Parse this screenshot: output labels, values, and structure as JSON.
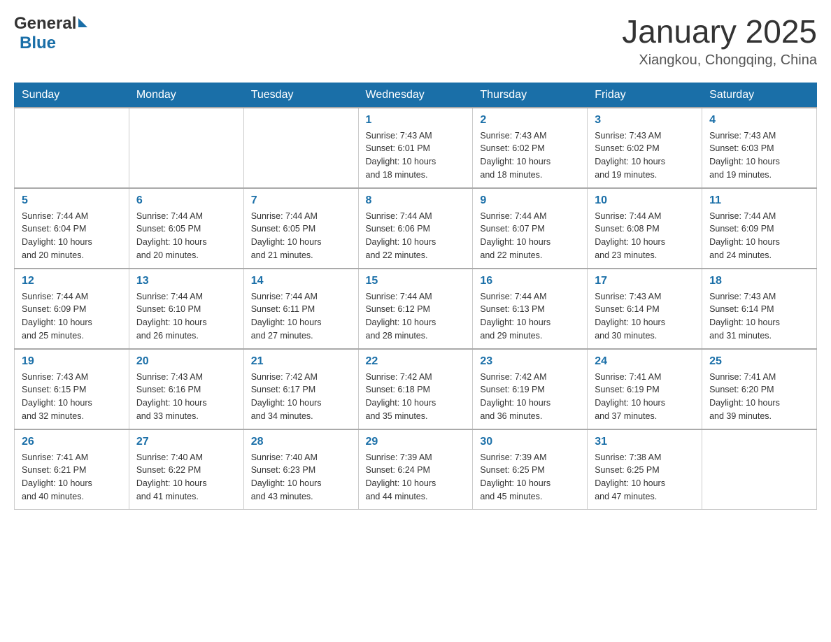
{
  "header": {
    "logo": {
      "general": "General",
      "blue": "Blue"
    },
    "title": "January 2025",
    "location": "Xiangkou, Chongqing, China"
  },
  "weekdays": [
    "Sunday",
    "Monday",
    "Tuesday",
    "Wednesday",
    "Thursday",
    "Friday",
    "Saturday"
  ],
  "weeks": [
    [
      {
        "day": "",
        "info": ""
      },
      {
        "day": "",
        "info": ""
      },
      {
        "day": "",
        "info": ""
      },
      {
        "day": "1",
        "info": "Sunrise: 7:43 AM\nSunset: 6:01 PM\nDaylight: 10 hours\nand 18 minutes."
      },
      {
        "day": "2",
        "info": "Sunrise: 7:43 AM\nSunset: 6:02 PM\nDaylight: 10 hours\nand 18 minutes."
      },
      {
        "day": "3",
        "info": "Sunrise: 7:43 AM\nSunset: 6:02 PM\nDaylight: 10 hours\nand 19 minutes."
      },
      {
        "day": "4",
        "info": "Sunrise: 7:43 AM\nSunset: 6:03 PM\nDaylight: 10 hours\nand 19 minutes."
      }
    ],
    [
      {
        "day": "5",
        "info": "Sunrise: 7:44 AM\nSunset: 6:04 PM\nDaylight: 10 hours\nand 20 minutes."
      },
      {
        "day": "6",
        "info": "Sunrise: 7:44 AM\nSunset: 6:05 PM\nDaylight: 10 hours\nand 20 minutes."
      },
      {
        "day": "7",
        "info": "Sunrise: 7:44 AM\nSunset: 6:05 PM\nDaylight: 10 hours\nand 21 minutes."
      },
      {
        "day": "8",
        "info": "Sunrise: 7:44 AM\nSunset: 6:06 PM\nDaylight: 10 hours\nand 22 minutes."
      },
      {
        "day": "9",
        "info": "Sunrise: 7:44 AM\nSunset: 6:07 PM\nDaylight: 10 hours\nand 22 minutes."
      },
      {
        "day": "10",
        "info": "Sunrise: 7:44 AM\nSunset: 6:08 PM\nDaylight: 10 hours\nand 23 minutes."
      },
      {
        "day": "11",
        "info": "Sunrise: 7:44 AM\nSunset: 6:09 PM\nDaylight: 10 hours\nand 24 minutes."
      }
    ],
    [
      {
        "day": "12",
        "info": "Sunrise: 7:44 AM\nSunset: 6:09 PM\nDaylight: 10 hours\nand 25 minutes."
      },
      {
        "day": "13",
        "info": "Sunrise: 7:44 AM\nSunset: 6:10 PM\nDaylight: 10 hours\nand 26 minutes."
      },
      {
        "day": "14",
        "info": "Sunrise: 7:44 AM\nSunset: 6:11 PM\nDaylight: 10 hours\nand 27 minutes."
      },
      {
        "day": "15",
        "info": "Sunrise: 7:44 AM\nSunset: 6:12 PM\nDaylight: 10 hours\nand 28 minutes."
      },
      {
        "day": "16",
        "info": "Sunrise: 7:44 AM\nSunset: 6:13 PM\nDaylight: 10 hours\nand 29 minutes."
      },
      {
        "day": "17",
        "info": "Sunrise: 7:43 AM\nSunset: 6:14 PM\nDaylight: 10 hours\nand 30 minutes."
      },
      {
        "day": "18",
        "info": "Sunrise: 7:43 AM\nSunset: 6:14 PM\nDaylight: 10 hours\nand 31 minutes."
      }
    ],
    [
      {
        "day": "19",
        "info": "Sunrise: 7:43 AM\nSunset: 6:15 PM\nDaylight: 10 hours\nand 32 minutes."
      },
      {
        "day": "20",
        "info": "Sunrise: 7:43 AM\nSunset: 6:16 PM\nDaylight: 10 hours\nand 33 minutes."
      },
      {
        "day": "21",
        "info": "Sunrise: 7:42 AM\nSunset: 6:17 PM\nDaylight: 10 hours\nand 34 minutes."
      },
      {
        "day": "22",
        "info": "Sunrise: 7:42 AM\nSunset: 6:18 PM\nDaylight: 10 hours\nand 35 minutes."
      },
      {
        "day": "23",
        "info": "Sunrise: 7:42 AM\nSunset: 6:19 PM\nDaylight: 10 hours\nand 36 minutes."
      },
      {
        "day": "24",
        "info": "Sunrise: 7:41 AM\nSunset: 6:19 PM\nDaylight: 10 hours\nand 37 minutes."
      },
      {
        "day": "25",
        "info": "Sunrise: 7:41 AM\nSunset: 6:20 PM\nDaylight: 10 hours\nand 39 minutes."
      }
    ],
    [
      {
        "day": "26",
        "info": "Sunrise: 7:41 AM\nSunset: 6:21 PM\nDaylight: 10 hours\nand 40 minutes."
      },
      {
        "day": "27",
        "info": "Sunrise: 7:40 AM\nSunset: 6:22 PM\nDaylight: 10 hours\nand 41 minutes."
      },
      {
        "day": "28",
        "info": "Sunrise: 7:40 AM\nSunset: 6:23 PM\nDaylight: 10 hours\nand 43 minutes."
      },
      {
        "day": "29",
        "info": "Sunrise: 7:39 AM\nSunset: 6:24 PM\nDaylight: 10 hours\nand 44 minutes."
      },
      {
        "day": "30",
        "info": "Sunrise: 7:39 AM\nSunset: 6:25 PM\nDaylight: 10 hours\nand 45 minutes."
      },
      {
        "day": "31",
        "info": "Sunrise: 7:38 AM\nSunset: 6:25 PM\nDaylight: 10 hours\nand 47 minutes."
      },
      {
        "day": "",
        "info": ""
      }
    ]
  ]
}
